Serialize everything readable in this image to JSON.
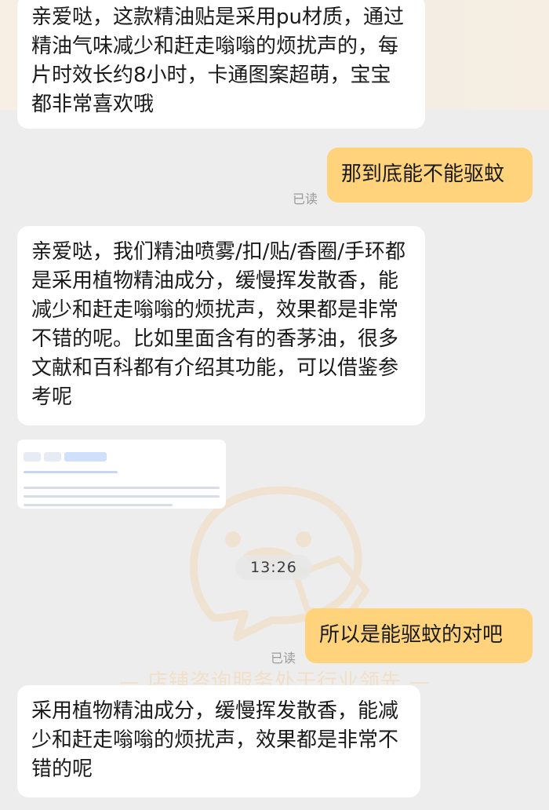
{
  "conversation": {
    "messages": [
      {
        "side": "left",
        "text": "亲爱哒，这款精油贴是采用pu材质，通过精油气味减少和赶走嗡嗡的烦扰声的，每片时效长约8小时，卡通图案超萌，宝宝都非常喜欢哦"
      },
      {
        "side": "right",
        "text": "那到底能不能驱蚊",
        "status": "已读"
      },
      {
        "side": "left",
        "text": "亲爱哒，我们精油喷雾/扣/贴/香圈/手环都是采用植物精油成分，缓慢挥发散香，能减少和赶走嗡嗡的烦扰声，效果都是非常不错的呢。比如里面含有的香茅油，很多文献和百科都有介绍其功能，可以借鉴参考呢"
      },
      {
        "side": "left",
        "type": "image"
      },
      {
        "type": "time",
        "text": "13:26"
      },
      {
        "side": "right",
        "text": "所以是能驱蚊的对吧",
        "status": "已读"
      },
      {
        "side": "left",
        "text": "采用植物精油成分，缓慢挥发散香，能减少和赶走嗡嗡的烦扰声，效果都是非常不错的呢"
      }
    ]
  },
  "watermark": {
    "slogan": "— 店铺咨询服务处于行业领先 —",
    "icon": "chat-mascot-icon"
  },
  "colors": {
    "background": "#ededed",
    "received_bubble": "#ffffff",
    "sent_bubble": "#fed37c",
    "read_status": "#9a9a9a",
    "watermark": "#f2dfc7"
  }
}
